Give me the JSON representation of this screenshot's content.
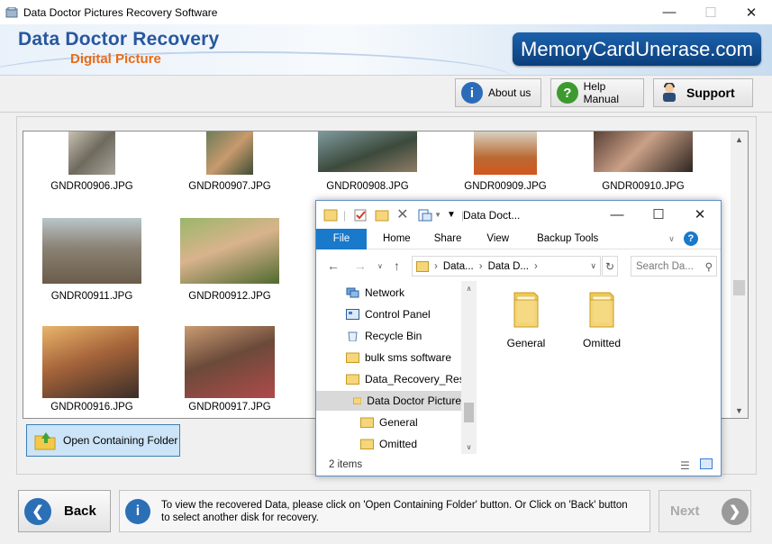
{
  "window": {
    "title": "Data Doctor Pictures Recovery Software",
    "minimize_icon": "minimize-icon",
    "maximize_icon": "maximize-icon",
    "close_icon": "close-icon"
  },
  "banner": {
    "brand_line1": "Data Doctor Recovery",
    "brand_line2": "Digital Picture",
    "logo_text": "MemoryCardUnerase.com"
  },
  "toolbar": {
    "about_label": "About us",
    "help_label": "Help Manual",
    "support_label": "Support"
  },
  "gallery": {
    "items": [
      {
        "name": "GNDR00906.JPG"
      },
      {
        "name": "GNDR00907.JPG"
      },
      {
        "name": "GNDR00908.JPG"
      },
      {
        "name": "GNDR00909.JPG"
      },
      {
        "name": "GNDR00910.JPG"
      },
      {
        "name": "GNDR00911.JPG"
      },
      {
        "name": "GNDR00912.JPG"
      },
      {
        "name": "GNDR00916.JPG"
      },
      {
        "name": "GNDR00917.JPG"
      }
    ]
  },
  "open_folder_button": "Open Containing Folder",
  "explorer": {
    "title": "Data Doct...",
    "ribbon_tabs": [
      "File",
      "Home",
      "Share",
      "View",
      "Backup Tools"
    ],
    "address_segments": [
      "Data...",
      "Data D..."
    ],
    "search_placeholder": "Search Da...",
    "tree": [
      "Network",
      "Control Panel",
      "Recycle Bin",
      "bulk sms software",
      "Data_Recovery_Resu",
      "Data Doctor Picture",
      "General",
      "Omitted"
    ],
    "folders": [
      "General",
      "Omitted"
    ],
    "status": "2 items"
  },
  "footer": {
    "back_label": "Back",
    "next_label": "Next",
    "info_text": "To view the recovered Data, please click on 'Open Containing Folder' button. Or Click on 'Back' button to select another disk for recovery."
  }
}
